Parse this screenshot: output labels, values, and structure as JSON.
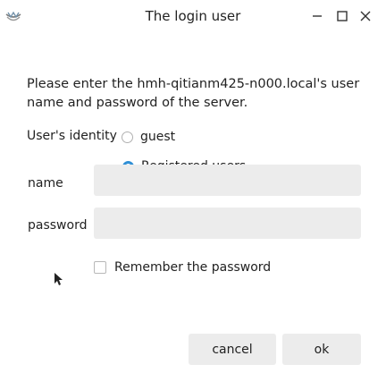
{
  "window": {
    "title": "The login user",
    "minimize_icon": "minimize-icon",
    "maximize_icon": "maximize-icon",
    "close_icon": "close-icon",
    "app_icon": "app-logo-icon"
  },
  "dialog": {
    "prompt": "Please enter the hmh-qitianm425-n000.local's user name and password of the server.",
    "identity_label": "User's identity",
    "options": {
      "guest": "guest",
      "registered": "Registered users",
      "selected": "registered"
    },
    "name_label": "name",
    "name_value": "",
    "password_label": "password",
    "password_value": "",
    "remember_label": "Remember the password",
    "remember_checked": false,
    "cancel_label": "cancel",
    "ok_label": "ok"
  },
  "colors": {
    "accent": "#2f8fd5",
    "field_bg": "#ececec"
  }
}
